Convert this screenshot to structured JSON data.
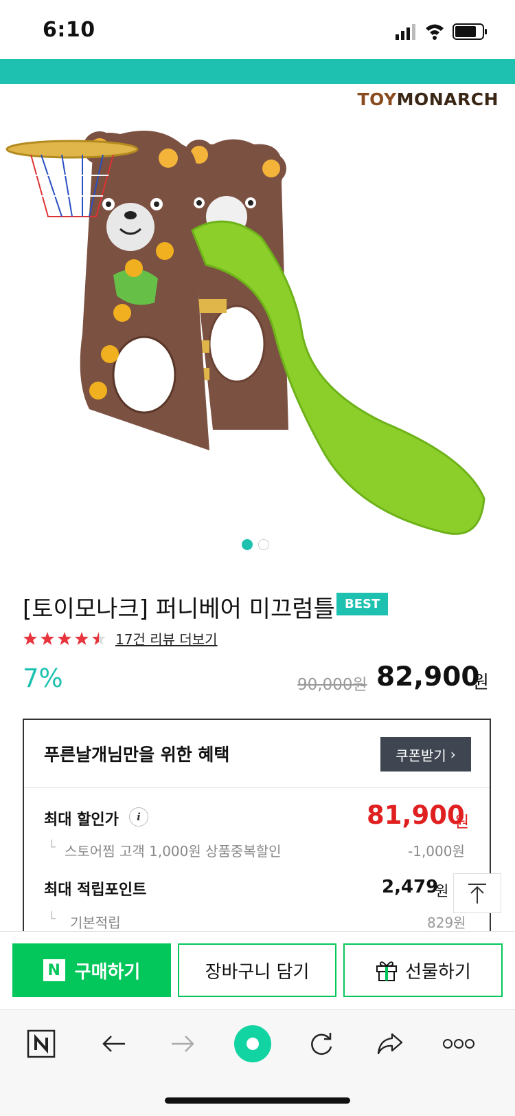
{
  "status_bar": {
    "time": "6:10"
  },
  "brand": {
    "logo_text_a": "TOY",
    "logo_text_b": "MONARCH"
  },
  "carousel": {
    "current": 1,
    "total": 2
  },
  "product": {
    "title": "[토이모나크] 퍼니베어 미끄럼틀",
    "badge": "BEST",
    "rating": 4.5,
    "review_link": "17건 리뷰 더보기",
    "discount_rate": "7%",
    "original_price": "90,000원",
    "sale_price": "82,900",
    "currency": "원"
  },
  "benefits": {
    "title": "푸른날개님만을 위한 혜택",
    "coupon_button": "쿠폰받기",
    "max_discount": {
      "label": "최대 할인가",
      "value": "81,900",
      "currency": "원"
    },
    "store_zzim": {
      "label": "스토어찜 고객 1,000원 상품중복할인",
      "value": "-1,000원"
    },
    "max_points": {
      "label": "최대 적립포인트",
      "value": "2,479",
      "currency": "원"
    },
    "basic_points": {
      "label": "기본적립",
      "value": "829원"
    }
  },
  "actions": {
    "buy": "구매하기",
    "cart": "장바구니 담기",
    "gift": "선물하기"
  },
  "colors": {
    "accent": "#1ec1b0",
    "naver_green": "#03c75a",
    "price_red": "#e02020"
  },
  "browser_toolbar": {
    "icons": [
      "naver-n-icon",
      "back-arrow-icon",
      "forward-arrow-icon",
      "green-dot-icon",
      "refresh-icon",
      "share-icon",
      "more-icon"
    ]
  }
}
